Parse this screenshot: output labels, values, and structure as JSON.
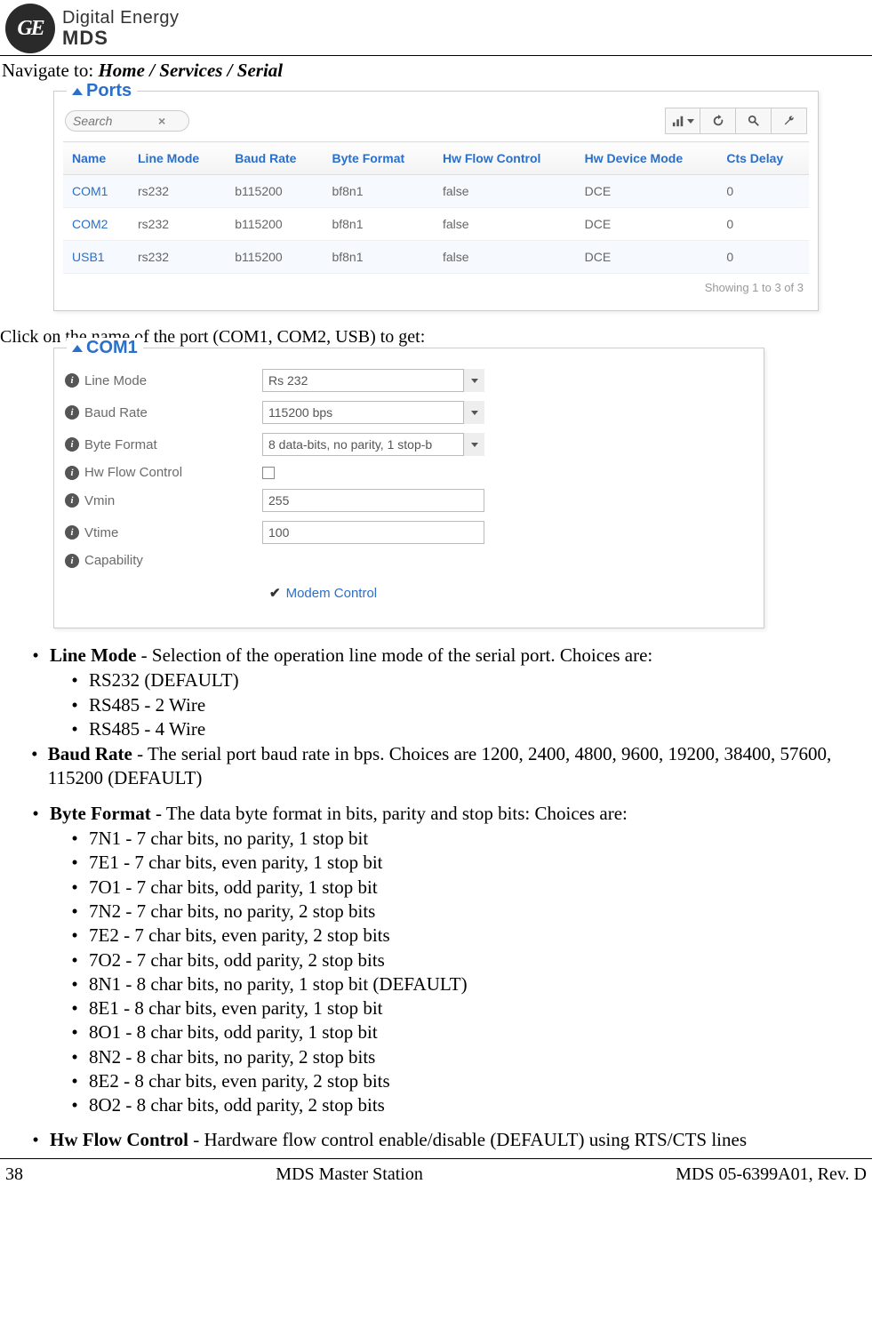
{
  "logo": {
    "ge_monogram": "GE",
    "top": "Digital Energy",
    "bottom": "MDS"
  },
  "navigate": {
    "prefix": "Navigate to: ",
    "path": "Home / Services / Serial"
  },
  "ports_panel": {
    "title": "Ports",
    "search_placeholder": "Search",
    "columns": [
      "Name",
      "Line Mode",
      "Baud Rate",
      "Byte Format",
      "Hw Flow Control",
      "Hw Device Mode",
      "Cts Delay"
    ],
    "rows": [
      {
        "name": "COM1",
        "line_mode": "rs232",
        "baud": "b115200",
        "byte": "bf8n1",
        "hw_flow": "false",
        "hw_dev": "DCE",
        "cts": "0"
      },
      {
        "name": "COM2",
        "line_mode": "rs232",
        "baud": "b115200",
        "byte": "bf8n1",
        "hw_flow": "false",
        "hw_dev": "DCE",
        "cts": "0"
      },
      {
        "name": "USB1",
        "line_mode": "rs232",
        "baud": "b115200",
        "byte": "bf8n1",
        "hw_flow": "false",
        "hw_dev": "DCE",
        "cts": "0"
      }
    ],
    "status": "Showing 1 to 3 of 3"
  },
  "click_text": "Click on the name of the port (COM1, COM2, USB) to get:",
  "com_panel": {
    "title": "COM1",
    "fields": {
      "line_mode": {
        "label": "Line Mode",
        "value": "Rs 232"
      },
      "baud_rate": {
        "label": "Baud Rate",
        "value": "115200 bps"
      },
      "byte_format": {
        "label": "Byte Format",
        "value": "8 data-bits, no parity, 1 stop-b"
      },
      "hw_flow": {
        "label": "Hw Flow Control"
      },
      "vmin": {
        "label": "Vmin",
        "value": "255"
      },
      "vtime": {
        "label": "Vtime",
        "value": "100"
      },
      "capability": {
        "label": "Capability"
      }
    },
    "modem_control": "Modem Control"
  },
  "descriptions": {
    "line_mode": {
      "term": "Line Mode",
      "text": " - Selection of the operation line mode of the serial port. Choices are:",
      "items": [
        "RS232 (DEFAULT)",
        "RS485 - 2 Wire",
        "RS485 - 4 Wire"
      ]
    },
    "baud_rate": {
      "term": "Baud Rate",
      "text": " - The serial port baud rate in bps. Choices are 1200, 2400, 4800, 9600, 19200, 38400, 57600, 115200 (DEFAULT)"
    },
    "byte_format": {
      "term": "Byte Format",
      "text": " - The data byte format in bits, parity and stop bits: Choices are:",
      "items": [
        "7N1 - 7 char bits, no parity, 1 stop bit",
        "7E1 - 7 char bits, even parity, 1 stop bit",
        "7O1 - 7 char bits, odd parity, 1 stop bit",
        "7N2 - 7 char bits, no parity, 2 stop bits",
        "7E2 - 7 char bits, even parity, 2 stop bits",
        "7O2 - 7 char bits, odd parity, 2 stop bits",
        "8N1 - 8 char bits, no parity, 1 stop bit (DEFAULT)",
        "8E1 - 8 char bits, even parity, 1 stop bit",
        "8O1 - 8 char bits, odd parity, 1 stop bit",
        "8N2 - 8 char bits, no parity, 2 stop bits",
        "8E2 - 8 char bits, even parity, 2 stop bits",
        "8O2 - 8 char bits, odd parity, 2 stop bits"
      ]
    },
    "hw_flow": {
      "term": "Hw Flow Control",
      "text": " - Hardware flow control enable/disable (DEFAULT) using RTS/CTS lines"
    }
  },
  "footer": {
    "page": "38",
    "title": "MDS Master Station",
    "doc": "MDS 05-6399A01, Rev. D"
  }
}
